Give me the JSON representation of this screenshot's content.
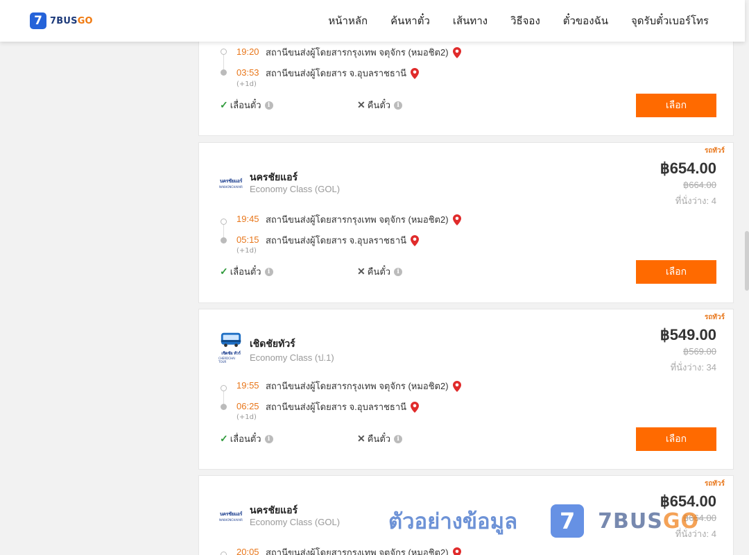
{
  "header": {
    "logo_number": "7",
    "logo_text_a": "7BUS",
    "logo_text_b": "GO",
    "nav": [
      "หน้าหลัก",
      "ค้นหาตั๋ว",
      "เส้นทาง",
      "วิธีจอง",
      "ตั๋วของฉัน",
      "จุดรับตั๋วเบอร์โทร"
    ]
  },
  "trips": [
    {
      "depart_time": "19:20",
      "depart_station": "สถานีขนส่งผู้โดยสารกรุงเทพ จตุจักร (หมอชิต2)",
      "arrive_time": "03:53",
      "arrive_station": "สถานีขนส่งผู้โดยสาร จ.อุบลราชธานี",
      "day_offset": "(+1d)",
      "reschedule": "เลื่อนตั๋ว",
      "refund": "คืนตั๋ว",
      "button": "เลือก"
    },
    {
      "tag": "รถทัวร์",
      "operator": "นครชัยแอร์",
      "class": "Economy Class (GOL)",
      "price": "฿654.00",
      "old_price": "฿664.00",
      "seats": "ที่นั่งว่าง: 4",
      "depart_time": "19:45",
      "depart_station": "สถานีขนส่งผู้โดยสารกรุงเทพ จตุจักร (หมอชิต2)",
      "arrive_time": "05:15",
      "arrive_station": "สถานีขนส่งผู้โดยสาร จ.อุบลราชธานี",
      "day_offset": "(+1d)",
      "reschedule": "เลื่อนตั๋ว",
      "refund": "คืนตั๋ว",
      "button": "เลือก",
      "logo_text": "นครชัยแอร์",
      "logo_subtext": "NAKHONCHAIAIR"
    },
    {
      "tag": "รถทัวร์",
      "operator": "เชิดชัยทัวร์",
      "class": "Economy Class (ป.1)",
      "price": "฿549.00",
      "old_price": "฿569.00",
      "seats": "ที่นั่งว่าง: 34",
      "depart_time": "19:55",
      "depart_station": "สถานีขนส่งผู้โดยสารกรุงเทพ จตุจักร (หมอชิต2)",
      "arrive_time": "06:25",
      "arrive_station": "สถานีขนส่งผู้โดยสาร จ.อุบลราชธานี",
      "day_offset": "(+1d)",
      "reschedule": "เลื่อนตั๋ว",
      "refund": "คืนตั๋ว",
      "button": "เลือก",
      "logo_text": "เชิดชัย ทัวร์",
      "logo_subtext": "CHERDCHAI TOUR"
    },
    {
      "tag": "รถทัวร์",
      "operator": "นครชัยแอร์",
      "class": "Economy Class (GOL)",
      "price": "฿654.00",
      "old_price": "฿664.00",
      "seats": "ที่นั่งว่าง: 4",
      "depart_time": "20:05",
      "depart_station": "สถานีขนส่งผู้โดยสารกรุงเทพ จตุจักร (หมอชิต2)",
      "logo_text": "นครชัยแอร์",
      "logo_subtext": "NAKHONCHAIAIR"
    }
  ],
  "watermark": {
    "text": "ตัวอย่างข้อมูล",
    "badge": "7",
    "brand_a": "7BUS",
    "brand_b": "GO"
  },
  "colors": {
    "accent": "#ff6a00",
    "time": "#e8761a",
    "brand_blue": "#2563d9",
    "check": "#2f9a3b"
  }
}
